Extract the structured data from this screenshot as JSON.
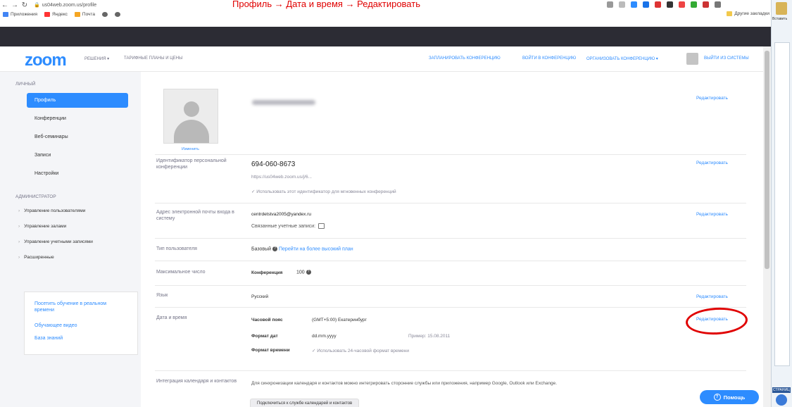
{
  "browser": {
    "url": "us04web.zoom.us/profile",
    "bookmarks": [
      "Приложения",
      "Яндекс",
      "Почта"
    ],
    "other_bookmarks": "Другие закладки"
  },
  "word_panel": {
    "paste_label": "Вставить",
    "pages_label": "СТРАНИЦ"
  },
  "header": {
    "logo": "zoom",
    "solutions": "РЕШЕНИЯ ▾",
    "plans": "ТАРИФНЫЕ ПЛАНЫ И ЦЕНЫ",
    "schedule": "ЗАПЛАНИРОВАТЬ КОНФЕРЕНЦИЮ",
    "join": "ВОЙТИ В КОНФЕРЕНЦИЮ",
    "host": "ОРГАНИЗОВАТЬ КОНФЕРЕНЦИЮ ▾",
    "signout": "ВЫЙТИ ИЗ СИСТЕМЫ"
  },
  "sidebar": {
    "personal_heading": "ЛИЧНЫЙ",
    "items": [
      "Профиль",
      "Конференции",
      "Веб-семинары",
      "Записи",
      "Настройки"
    ],
    "admin_heading": "АДМИНИСТРАТОР",
    "admin_items": [
      "Управление пользователями",
      "Управление залами",
      "Управление учетными записями",
      "Расширенные"
    ],
    "links": [
      "Посетить обучение в реальном времени",
      "Обучающее видео",
      "База знаний"
    ]
  },
  "profile": {
    "change_photo": "Изменить",
    "edit": "Редактировать",
    "pmi_label": "Идентификатор персональной конференции",
    "pmi_value": "694-060-8673",
    "pmi_url": "https://us04web.zoom.us/j/6...",
    "pmi_option": "Использовать этот идентификатор для мгновенных конференций",
    "email_label": "Адрес электронной почты входа в систему",
    "email_value": "centrdetstva2005@yandex.ru",
    "linked_accounts": "Связанные учетные записи:",
    "usertype_label": "Тип пользователя",
    "usertype_value": "Базовый",
    "upgrade_link": "Перейти на более высокий план",
    "capacity_label": "Максимальное число",
    "capacity_kind": "Конференция",
    "capacity_value": "100",
    "language_label": "Язык",
    "language_value": "Русский",
    "datetime_label": "Дата и время",
    "timezone_label": "Часовой пояс",
    "timezone_value": "(GMT+5:00) Екатеринбург",
    "dateformat_label": "Формат дат",
    "dateformat_value": "dd.mm.yyyy",
    "dateformat_example": "Пример: 15.08.2011",
    "timeformat_label": "Формат времени",
    "timeformat_value": "Использовать 24-часовой формат времени",
    "calendar_label": "Интеграция календаря и контактов",
    "calendar_desc": "Для синхронизации календаря и контактов можно интегрировать сторонние службы или приложения, например Google, Outlook или Exchange.",
    "calendar_button": "Подключиться к службе календарей и контактов"
  },
  "help_button": "Помощь",
  "annotation": {
    "color": "#e00000",
    "note": "Профиль → Дата и время → Редактировать"
  }
}
